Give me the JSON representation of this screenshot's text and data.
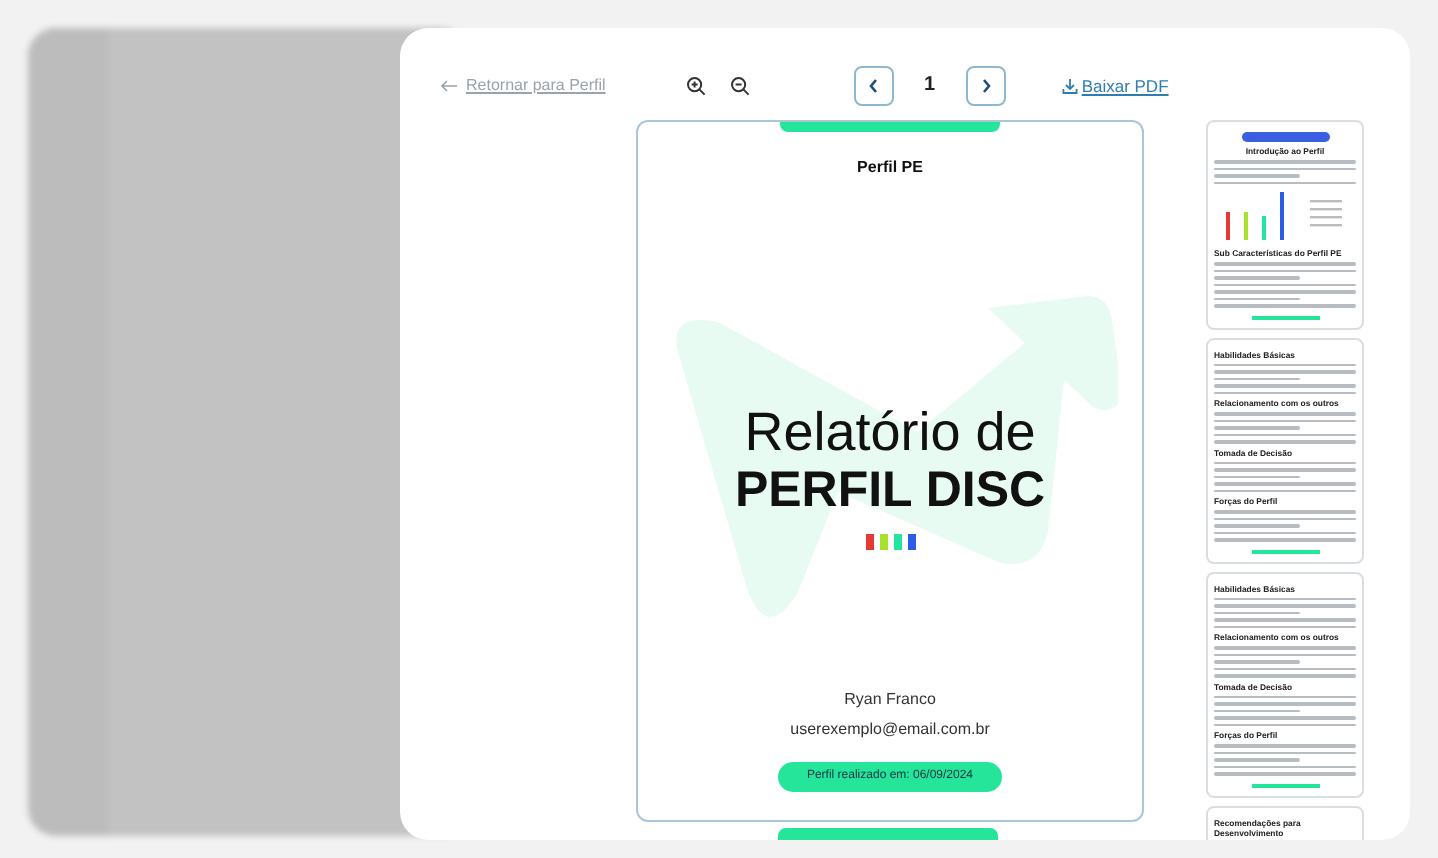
{
  "back_link": {
    "label": "Retornar para Perfil"
  },
  "pager": {
    "page": "1"
  },
  "download": {
    "label": "Baixar PDF"
  },
  "page": {
    "header": "Perfil PE",
    "title_line1": "Relatório de",
    "title_line2": "PERFIL DISC",
    "color_bars": [
      {
        "color": "#e53935"
      },
      {
        "color": "#a6e22e"
      },
      {
        "color": "#22e6a0"
      },
      {
        "color": "#2b5ce6"
      }
    ],
    "name": "Ryan Franco",
    "email": "userexemplo@email.com.br",
    "date_pill": "Perfil realizado em: 06/09/2024"
  },
  "thumbnails": [
    {
      "kind": "chart",
      "sections": [
        "Introdução ao Perfil",
        "Sub Características do Perfil PE"
      ]
    },
    {
      "kind": "text",
      "sections": [
        "Habilidades Básicas",
        "Relacionamento com os outros",
        "Tomada de Decisão",
        "Forças do Perfil"
      ]
    },
    {
      "kind": "text",
      "sections": [
        "Habilidades Básicas",
        "Relacionamento com os outros",
        "Tomada de Decisão",
        "Forças do Perfil"
      ]
    },
    {
      "kind": "text",
      "sections": [
        "Recomendações para Desenvolvimento"
      ]
    }
  ]
}
